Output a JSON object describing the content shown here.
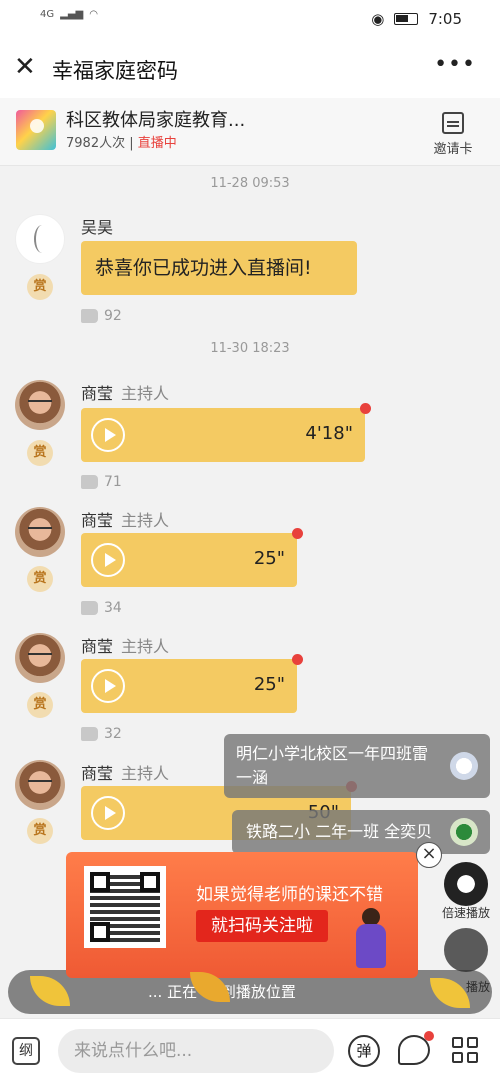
{
  "status": {
    "network": "4G",
    "time": "7:05"
  },
  "header": {
    "title": "幸福家庭密码",
    "more": "•••"
  },
  "room": {
    "name": "科区教体局家庭教育...",
    "viewers": "7982人次",
    "state": "直播中",
    "invite_label": "邀请卡"
  },
  "messages": [
    {
      "time": "11-28 09:53"
    },
    {
      "name": "吴昊",
      "role": "",
      "text": "恭喜你已成功进入直播间!",
      "likes": "92",
      "reward": "赏"
    },
    {
      "time": "11-30 18:23"
    },
    {
      "name": "商莹",
      "role": "主持人",
      "duration": "4'18\"",
      "likes": "71",
      "reward": "赏"
    },
    {
      "name": "商莹",
      "role": "主持人",
      "duration": "25\"",
      "likes": "34",
      "reward": "赏"
    },
    {
      "name": "商莹",
      "role": "主持人",
      "duration": "25\"",
      "likes": "32",
      "reward": "赏"
    },
    {
      "name": "商莹",
      "role": "主持人",
      "duration": "50\"",
      "reward": "赏"
    }
  ],
  "viewers_popups": [
    {
      "text": "明仁小学北校区一年四班雷一涵"
    },
    {
      "text": "铁路二小 二年一班 全奕贝"
    }
  ],
  "side_buttons": {
    "speed_label": "倍速播放",
    "app_label": "播放"
  },
  "promo": {
    "line1": "如果觉得老师的课还不错",
    "button": "就扫码关注啦",
    "close": "×"
  },
  "dim_bar": {
    "text": "... 正在 ... 到播放位置"
  },
  "bottom": {
    "outline_label": "纲",
    "input_placeholder": "来说点什么吧...",
    "danmu_label": "弹"
  },
  "colors": {
    "bubble": "#f4ca62",
    "live": "#e8413c",
    "promo": "#ef5a34"
  }
}
